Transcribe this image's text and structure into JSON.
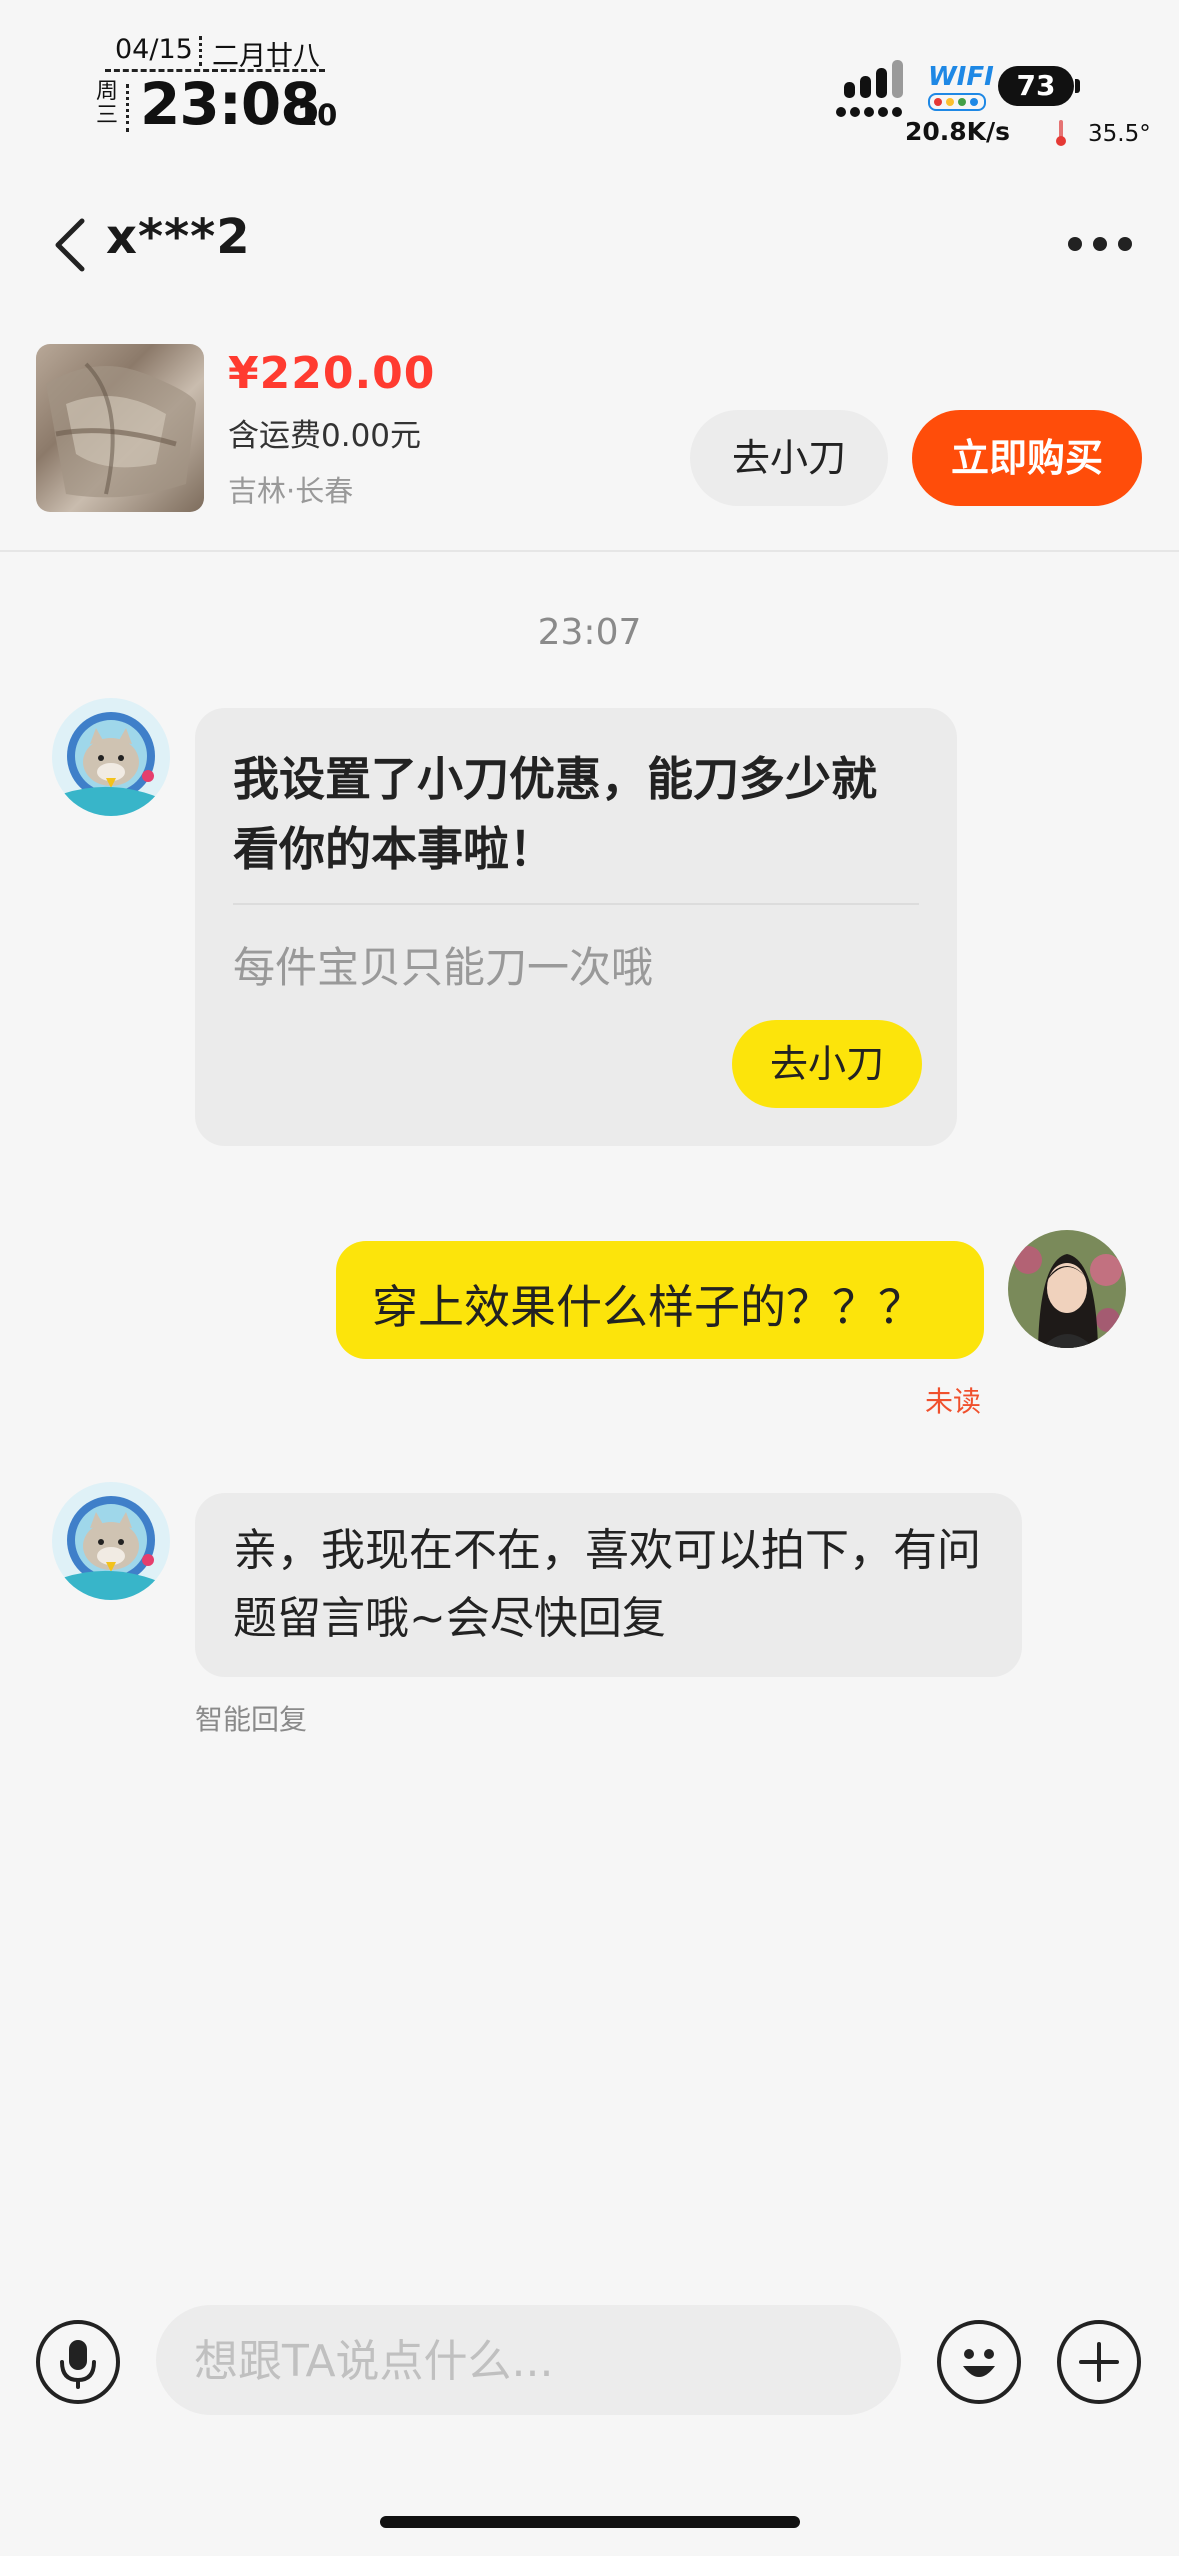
{
  "status_bar": {
    "date": "04/15",
    "lunar": "二月廿八",
    "weekday": "周三",
    "time": "23:08",
    "seconds": "10",
    "wifi_label": "WIFI",
    "net_speed": "20.8K/s",
    "battery": "73",
    "temperature": "35.5°"
  },
  "nav": {
    "title": "x***2",
    "back_icon": "chevron-left-icon",
    "more_icon": "more-horizontal-icon"
  },
  "product": {
    "price": "¥220.00",
    "shipping": "含运费0.00元",
    "location": "吉林·长春",
    "kan_button": "去小刀",
    "buy_button": "立即购买",
    "buy_color": "#ff4d0a",
    "price_color": "#ff3b30"
  },
  "chat": {
    "timestamp": "23:07",
    "seller_card": {
      "title": "我设置了小刀优惠，能刀多少就看你的本事啦！",
      "subtitle": "每件宝贝只能刀一次哦",
      "button": "去小刀"
    },
    "buyer_message": {
      "text": "穿上效果什么样子的？？？",
      "status": "未读"
    },
    "auto_reply": {
      "text": "亲，我现在不在，喜欢可以拍下，有问题留言哦~会尽快回复",
      "label": "智能回复"
    },
    "accent_yellow": "#fce40b"
  },
  "input_bar": {
    "placeholder": "想跟TA说点什么...",
    "voice_icon": "microphone-icon",
    "emoji_icon": "emoji-icon",
    "plus_icon": "plus-icon"
  }
}
